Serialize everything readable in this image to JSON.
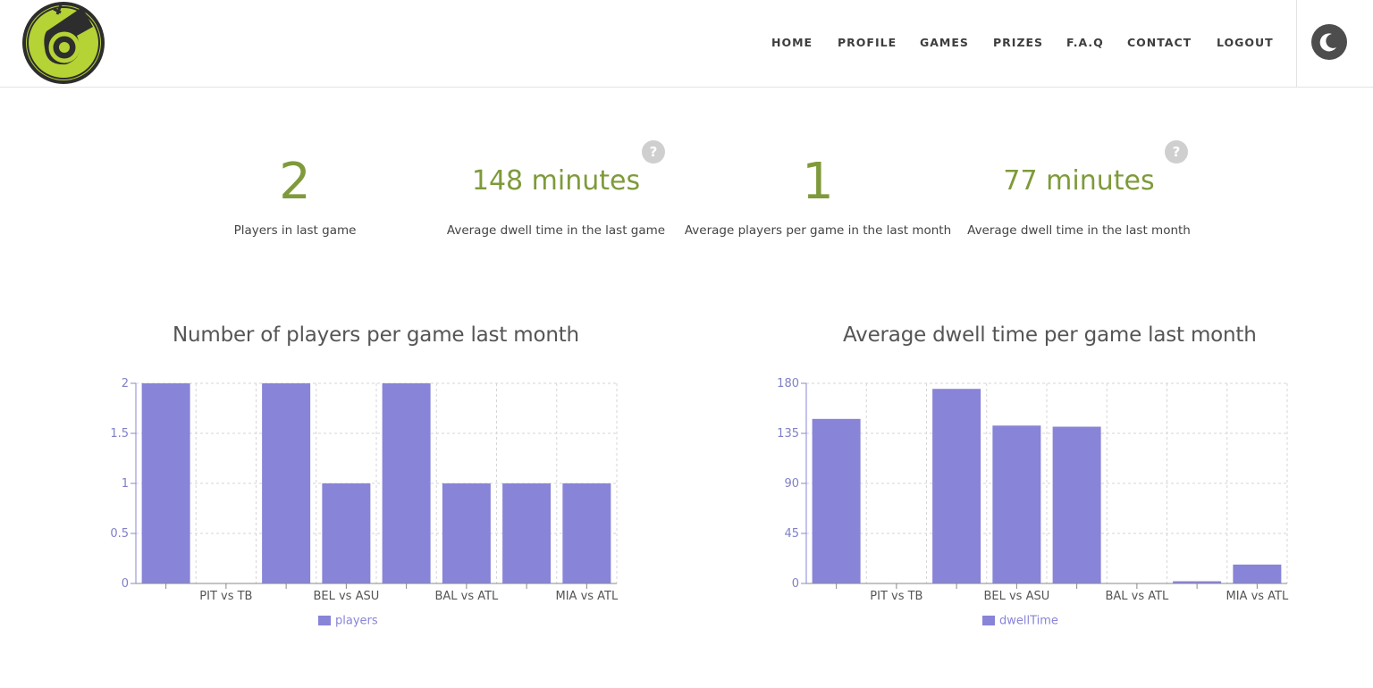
{
  "nav": {
    "items": [
      "HOME",
      "PROFILE",
      "GAMES",
      "PRIZES",
      "F.A.Q",
      "CONTACT",
      "LOGOUT"
    ]
  },
  "colors": {
    "accent": "#7f9a3b",
    "bar": "#8884d8",
    "logo_green": "#b5d335"
  },
  "icons": {
    "logo": "whistle-logo",
    "theme": "moon-icon",
    "help": "question-icon"
  },
  "help_text": "?",
  "stats": [
    {
      "value": "2",
      "label": "Players in last game"
    },
    {
      "value": "148 minutes",
      "label": "Average dwell time in the last game"
    },
    {
      "value": "1",
      "label": "Average players per game in the last month"
    },
    {
      "value": "77 minutes",
      "label": "Average dwell time in the last month"
    }
  ],
  "chart_data": [
    {
      "type": "bar",
      "title": "Number of players per game last month",
      "categories": [
        "",
        "PIT vs TB",
        "",
        "BEL vs ASU",
        "",
        "BAL vs ATL",
        "",
        "MIA vs ATL"
      ],
      "series": [
        {
          "name": "players",
          "values": [
            2,
            0,
            2,
            1,
            2,
            1,
            1,
            1
          ]
        }
      ],
      "ylim": [
        0,
        2
      ],
      "yticks": [
        "0",
        "0.5",
        "1",
        "1.5",
        "2"
      ],
      "grid": true,
      "legend": "bottom"
    },
    {
      "type": "bar",
      "title": "Average dwell time per game last month",
      "categories": [
        "",
        "PIT vs TB",
        "",
        "BEL vs ASU",
        "",
        "BAL vs ATL",
        "",
        "MIA vs ATL"
      ],
      "series": [
        {
          "name": "dwellTime",
          "values": [
            148,
            0,
            175,
            142,
            141,
            0,
            2,
            17
          ]
        }
      ],
      "ylim": [
        0,
        180
      ],
      "yticks": [
        "0",
        "45",
        "90",
        "135",
        "180"
      ],
      "grid": true,
      "legend": "bottom"
    }
  ]
}
